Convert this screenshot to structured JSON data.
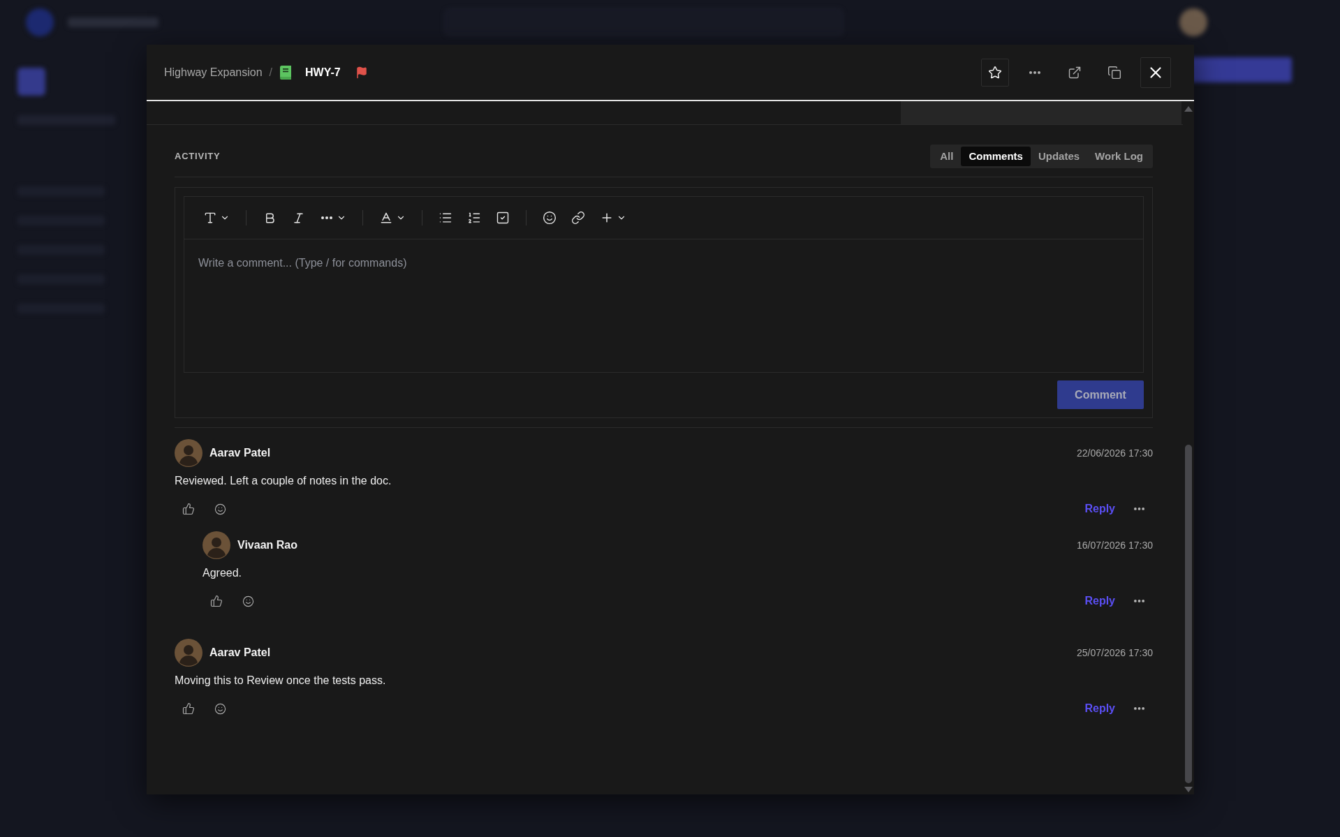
{
  "breadcrumb": {
    "project": "Highway Expansion",
    "separator": "/",
    "issue_key": "HWY-7"
  },
  "activity": {
    "title": "ACTIVITY",
    "tabs": [
      {
        "label": "All",
        "selected": false
      },
      {
        "label": "Comments",
        "selected": true
      },
      {
        "label": "Updates",
        "selected": false
      },
      {
        "label": "Work Log",
        "selected": false
      }
    ]
  },
  "editor": {
    "placeholder": "Write a comment... (Type / for commands)",
    "submit": {
      "label": "Comment",
      "disabled": true
    }
  },
  "comments": [
    {
      "author": "Aarav Patel",
      "time": "22/06/2026 17:30",
      "text": "Reviewed. Left a couple of notes in the doc.",
      "reply_button": "Reply",
      "replies": [
        {
          "author": "Vivaan Rao",
          "time": "16/07/2026 17:30",
          "text": "Agreed.",
          "reply_button": "Reply"
        }
      ]
    },
    {
      "author": "Aarav Patel",
      "time": "25/07/2026 17:30",
      "text": "Moving this to Review once the tests pass.",
      "reply_button": "Reply"
    }
  ]
}
